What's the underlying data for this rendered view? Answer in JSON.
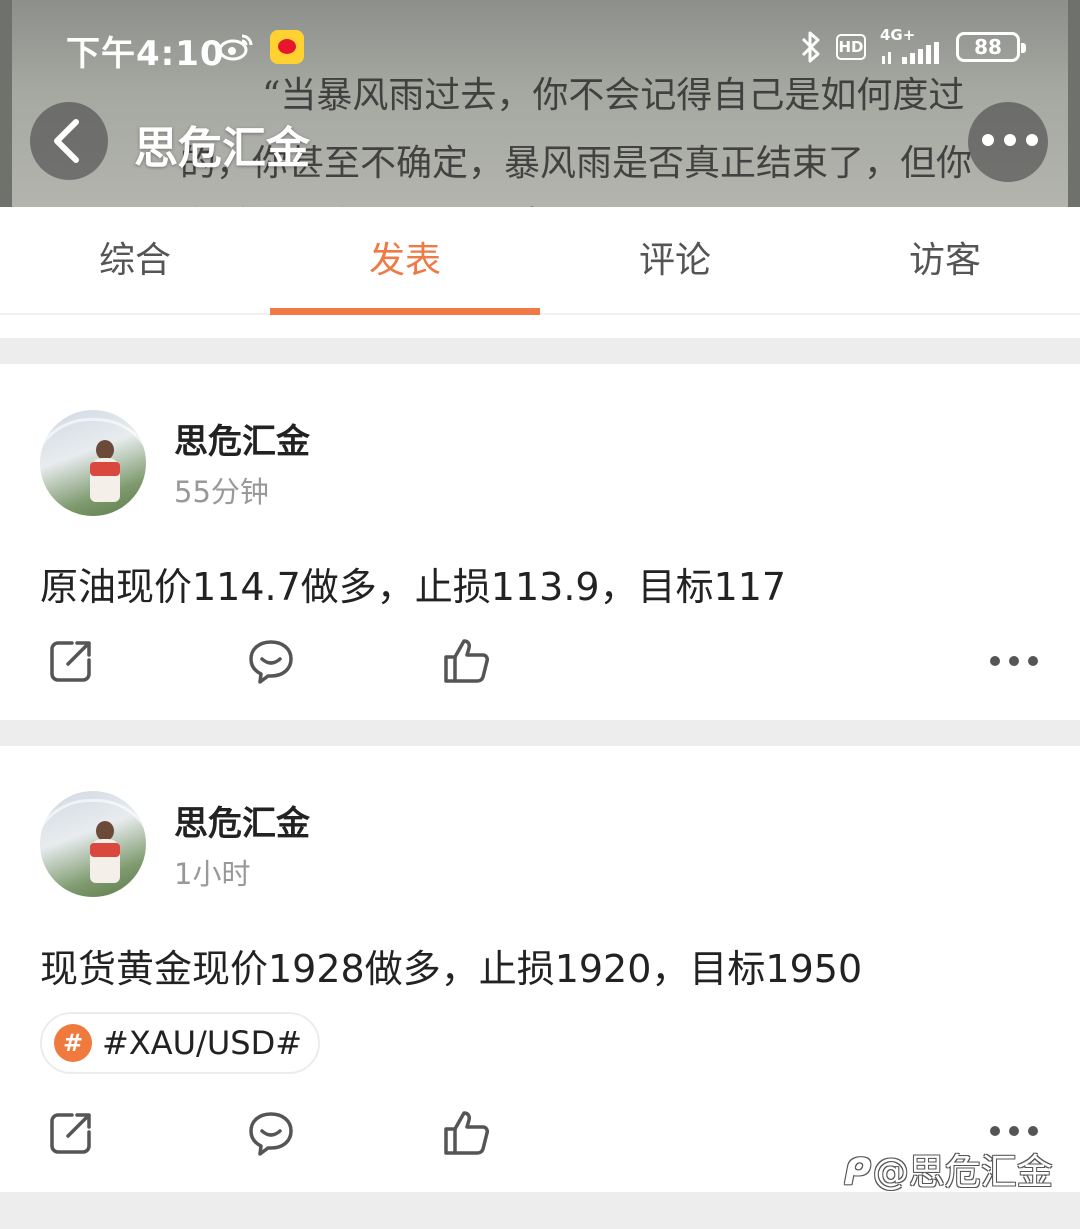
{
  "status_bar": {
    "time": "下午4:10",
    "network_label": "4G+",
    "hd_label": "HD",
    "battery": "88"
  },
  "header": {
    "title": "思危汇金",
    "background_text": [
      "“当暴风雨过去，你不会记得自己是如何度过",
      "的，你甚至不确定，暴风雨是否真正结束了，但你",
      "知道你已经不再是原来那个人了"
    ]
  },
  "tabs": [
    {
      "label": "综合",
      "active": false
    },
    {
      "label": "发表",
      "active": true
    },
    {
      "label": "评论",
      "active": false
    },
    {
      "label": "访客",
      "active": false
    }
  ],
  "posts": [
    {
      "author": "思危汇金",
      "time": "55分钟",
      "content": "原油现价114.7做多，止损113.9，目标117"
    },
    {
      "author": "思危汇金",
      "time": "1小时",
      "content": "现货黄金现价1928做多，止损1920，目标1950",
      "topic": "#XAU/USD#",
      "topic_badge": "#"
    }
  ],
  "watermark": {
    "text": "@思危汇金"
  },
  "colors": {
    "accent": "#ef7a46",
    "divider": "#ededed",
    "muted_text": "#999999",
    "icon": "#555555"
  },
  "icons": [
    "back-icon",
    "weibo-icon",
    "bluetooth-icon",
    "signal-icon",
    "battery-icon",
    "share-icon",
    "comment-icon",
    "like-icon",
    "more-icon"
  ]
}
